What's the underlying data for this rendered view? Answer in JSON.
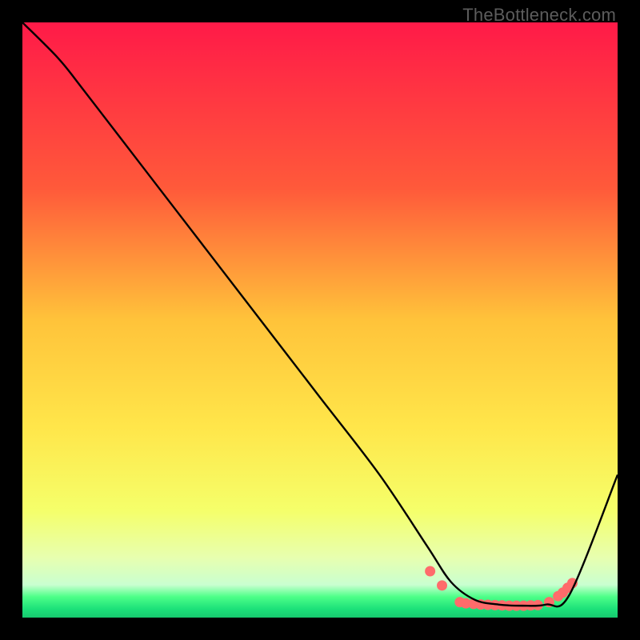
{
  "watermark": "TheBottleneck.com",
  "chart_data": {
    "type": "line",
    "title": "",
    "xlabel": "",
    "ylabel": "",
    "xlim": [
      0,
      100
    ],
    "ylim": [
      0,
      100
    ],
    "grid": false,
    "legend": false,
    "gradient_stops": [
      {
        "offset": 0,
        "color": "#ff1a48"
      },
      {
        "offset": 0.28,
        "color": "#ff5a3a"
      },
      {
        "offset": 0.5,
        "color": "#ffc33a"
      },
      {
        "offset": 0.68,
        "color": "#ffe64a"
      },
      {
        "offset": 0.82,
        "color": "#f5ff6a"
      },
      {
        "offset": 0.9,
        "color": "#e7ffb0"
      },
      {
        "offset": 0.945,
        "color": "#c9ffd0"
      },
      {
        "offset": 0.965,
        "color": "#4dff88"
      },
      {
        "offset": 0.985,
        "color": "#1de27a"
      },
      {
        "offset": 1.0,
        "color": "#16c96e"
      }
    ],
    "series": [
      {
        "name": "curve",
        "color": "#000000",
        "x": [
          0,
          6,
          10,
          20,
          30,
          40,
          50,
          60,
          68,
          72,
          76,
          80,
          84,
          88,
          92,
          100
        ],
        "y": [
          100,
          94,
          89,
          76,
          63,
          50,
          37,
          24,
          12,
          6,
          3,
          2.2,
          2,
          2.2,
          4,
          24
        ]
      }
    ],
    "markers": {
      "name": "dots",
      "color": "#ff6b6b",
      "radius": 6.5,
      "x": [
        68.5,
        70.5,
        73.5,
        74.5,
        75.8,
        77,
        78.2,
        79.4,
        80.6,
        81.8,
        83,
        84.2,
        85.4,
        86.6,
        88.5,
        90,
        90.8,
        91.6,
        92.4
      ],
      "y": [
        7.8,
        5.4,
        2.6,
        2.4,
        2.3,
        2.2,
        2.15,
        2.1,
        2.05,
        2.0,
        2.0,
        2.0,
        2.05,
        2.1,
        2.6,
        3.6,
        4.2,
        5.0,
        5.8
      ]
    }
  }
}
